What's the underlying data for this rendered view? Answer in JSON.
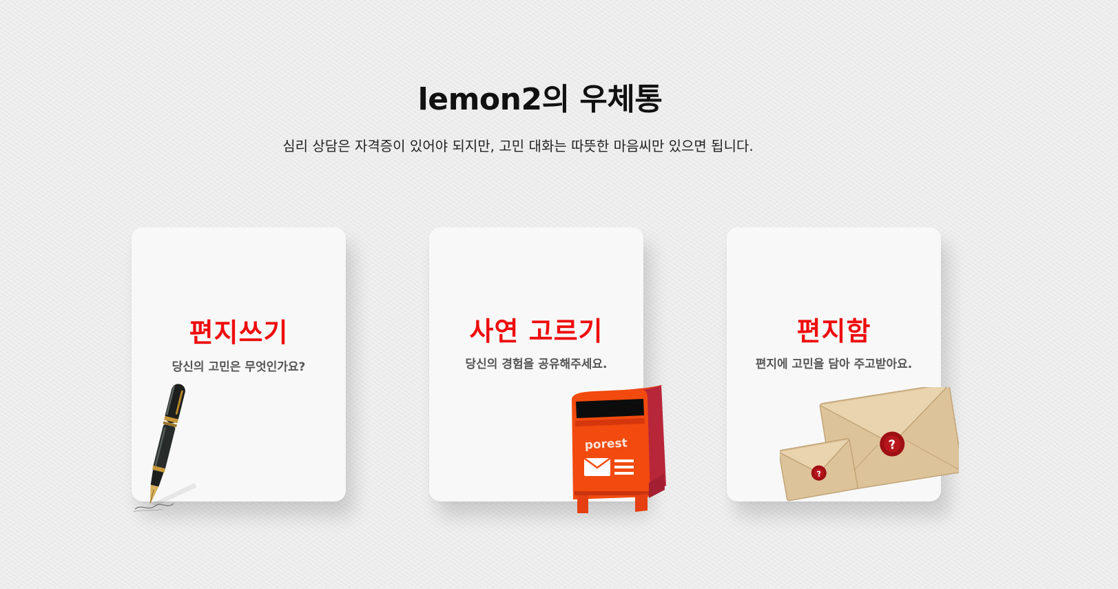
{
  "header": {
    "title": "lemon2의 우체통",
    "subtitle": "심리 상담은 자격증이 있어야 되지만, 고민 대화는 따뜻한 마음씨만 있으면 됩니다."
  },
  "cards": [
    {
      "title": "편지쓰기",
      "description": "당신의 고민은 무엇인가요?",
      "illustration": "fountain-pen"
    },
    {
      "title": "사연 고르기",
      "description": "당신의 경험을 공유해주세요.",
      "illustration": "red-postbox",
      "postbox_label": "porest"
    },
    {
      "title": "편지함",
      "description": "편지에 고민을 담아 주고받아요.",
      "illustration": "sealed-envelopes",
      "seal_mark": "?"
    }
  ],
  "colors": {
    "accent_red": "#ee0d0d",
    "postbox_orange": "#f24a0f",
    "envelope_tan": "#dcc39a",
    "wax_seal": "#9e0f14",
    "card_background": "#f8f8f8",
    "page_background": "#ececec"
  }
}
